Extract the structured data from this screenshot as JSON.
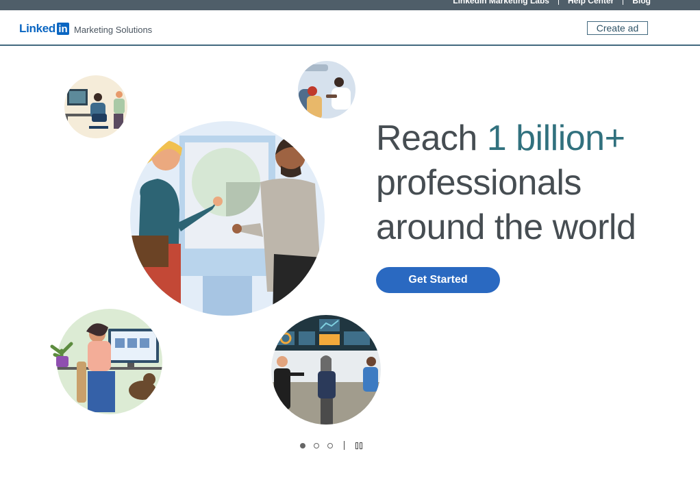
{
  "topbar": {
    "links": [
      "LinkedIn Marketing Labs",
      "Help Center",
      "Blog"
    ]
  },
  "header": {
    "logo_word": "Linked",
    "logo_box": "in",
    "subtitle": "Marketing Solutions",
    "create_ad_label": "Create ad"
  },
  "hero": {
    "line1_prefix": "Reach ",
    "line1_accent": "1 billion+",
    "line2": "professionals",
    "line3": "around the world",
    "cta_label": "Get Started"
  },
  "carousel": {
    "slide_count": 3,
    "active_index": 0
  },
  "colors": {
    "topbar": "#4f5e69",
    "brand": "#0a66c2",
    "accent": "#31717e",
    "cta": "#2a69c1",
    "header_border": "#41687e"
  },
  "icons": [
    "linkedin-logo",
    "pause-icon"
  ]
}
